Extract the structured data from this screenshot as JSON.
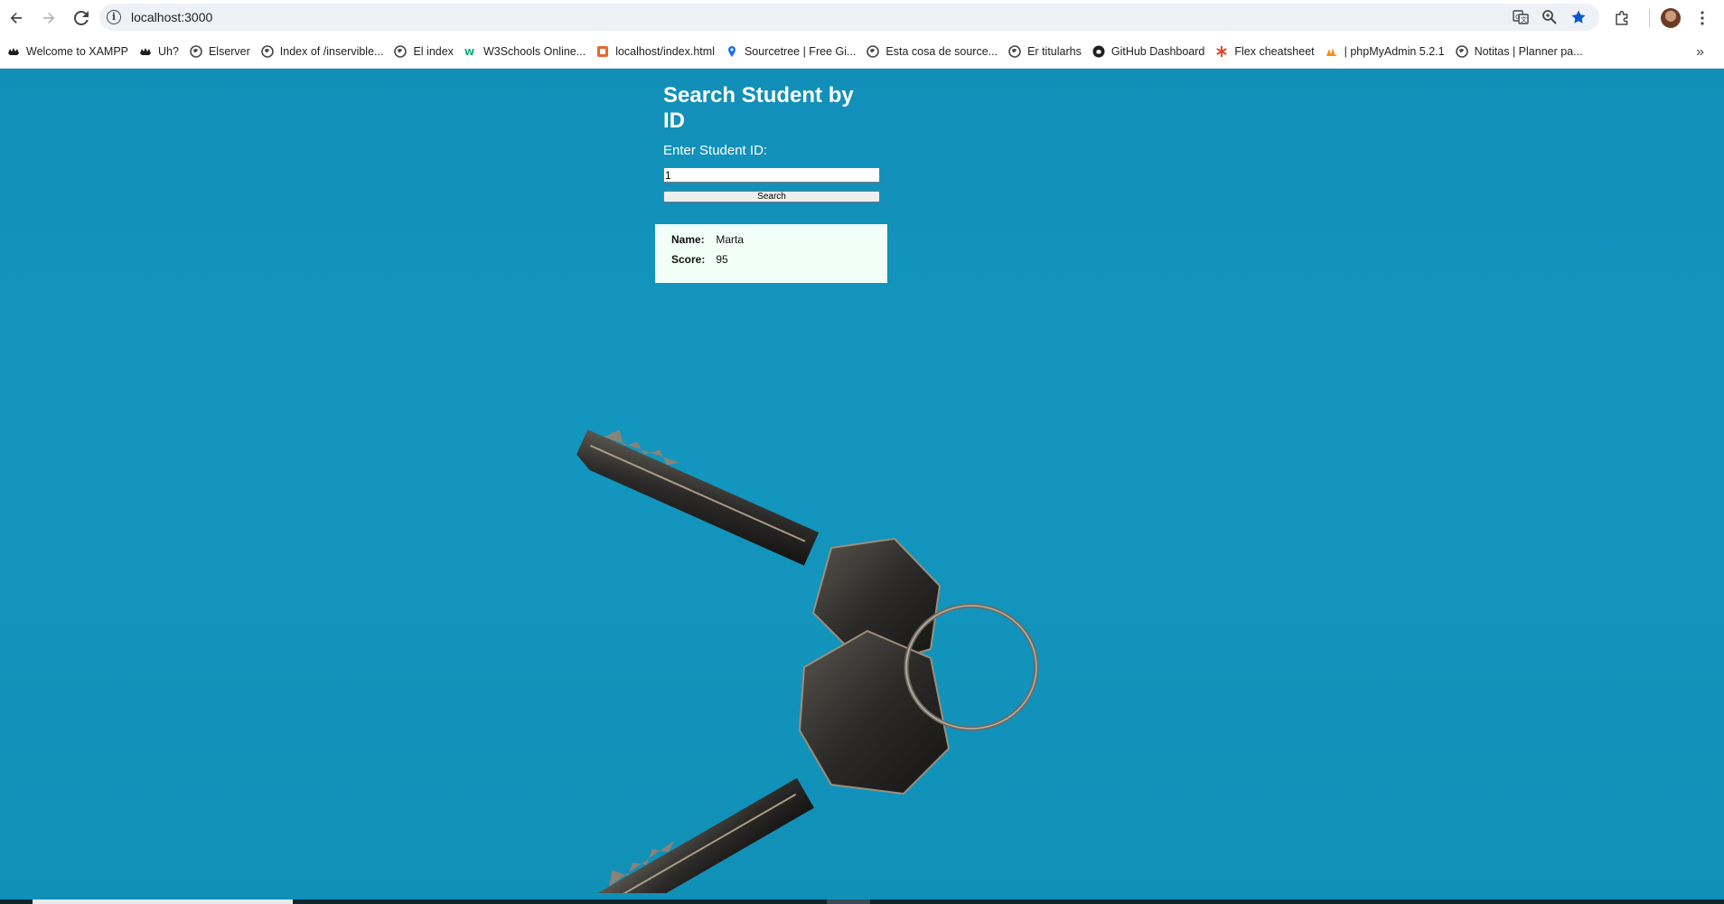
{
  "browser": {
    "url": "localhost:3000",
    "bookmarks": [
      {
        "label": "Welcome to XAMPP",
        "icon": "xampp-icon"
      },
      {
        "label": "Uh?",
        "icon": "xampp-icon"
      },
      {
        "label": "Elserver",
        "icon": "globe-icon"
      },
      {
        "label": "Index of /inservible...",
        "icon": "globe-icon"
      },
      {
        "label": "El index",
        "icon": "globe-icon"
      },
      {
        "label": "W3Schools Online...",
        "icon": "w3schools-icon"
      },
      {
        "label": "localhost/index.html",
        "icon": "html-icon"
      },
      {
        "label": "Sourcetree | Free Gi...",
        "icon": "pin-icon"
      },
      {
        "label": "Esta cosa de source...",
        "icon": "globe-icon"
      },
      {
        "label": "Er titularhs",
        "icon": "globe-icon"
      },
      {
        "label": "GitHub Dashboard",
        "icon": "github-icon"
      },
      {
        "label": "Flex cheatsheet",
        "icon": "asterisk-icon"
      },
      {
        "label": "| phpMyAdmin 5.2.1",
        "icon": "phpmyadmin-icon"
      },
      {
        "label": "Notitas | Planner pa...",
        "icon": "globe-icon"
      }
    ]
  },
  "page": {
    "title": "Search Student by ID",
    "input_label": "Enter Student ID:",
    "input_value": "1",
    "search_label": "Search",
    "result": {
      "name_label": "Name:",
      "name_value": "Marta",
      "score_label": "Score:",
      "score_value": "95"
    }
  },
  "colors": {
    "background": "#1296bf",
    "result_bg": "#f1fff8",
    "title": "#ffffff"
  }
}
